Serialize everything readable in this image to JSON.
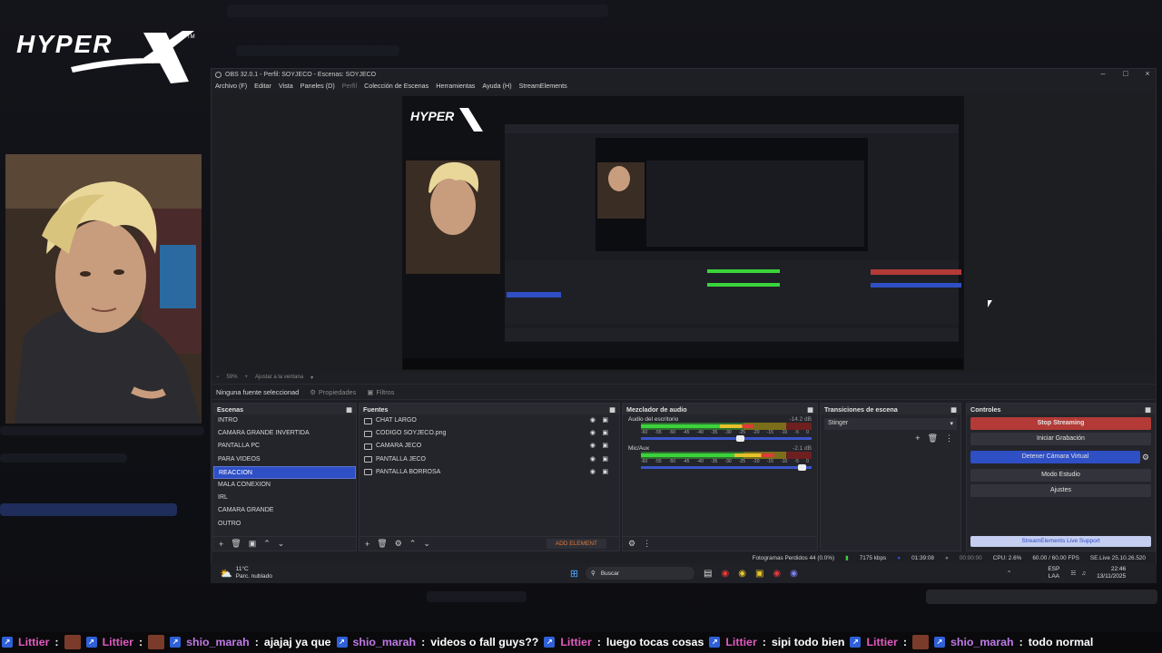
{
  "obs": {
    "title": "OBS 32.0.1 - Perfil: SOYJECO - Escenas: SOYJECO",
    "menu": [
      "Archivo (F)",
      "Editar",
      "Vista",
      "Paneles (D)",
      "Perfil",
      "Colección de Escenas",
      "Herramientas",
      "Ayuda (H)",
      "StreamElements"
    ],
    "zoom": "59%",
    "fit_label": "Ajustar a la ventana",
    "no_source": "Ninguna fuente seleccionad",
    "properties_tab": "Propiedades",
    "filters_tab": "Filtros"
  },
  "scenes": {
    "title": "Escenas",
    "items": [
      "INTRO",
      "CAMARA GRANDE INVERTIDA",
      "PANTALLA PC",
      "PARA VIDEOS",
      "REACCION",
      "MALA CONEXION",
      "IRL",
      "CAMARA GRANDE",
      "OUTRO"
    ],
    "selected_index": 4
  },
  "sources": {
    "title": "Fuentes",
    "items": [
      "CHAT LARGO",
      "CODIGO SOYJECO.png",
      "CAMARA JECO",
      "PANTALLA JECO",
      "PANTALLA BORROSA"
    ],
    "add_element": "ADD ELEMENT"
  },
  "mixer": {
    "title": "Mezclador de audio",
    "tracks": [
      {
        "name": "Audio del escritorio",
        "db": "-14.2 dB",
        "level": 0.66,
        "volume": 0.58
      },
      {
        "name": "Mic/Aux",
        "db": "-2.1 dB",
        "level": 0.78,
        "volume": 0.94
      }
    ],
    "scale": [
      "-60",
      "-55",
      "-50",
      "-45",
      "-40",
      "-35",
      "-30",
      "-25",
      "-20",
      "-15",
      "-10",
      "-5",
      "0"
    ]
  },
  "transitions": {
    "title": "Transiciones de escena",
    "selected": "Stinger"
  },
  "controls": {
    "title": "Controles",
    "stop_streaming": "Stop Streaming",
    "start_recording": "Iniciar Grabación",
    "stop_virtual_cam": "Detener Cámara Virtual",
    "studio_mode": "Modo Estudio",
    "settings": "Ajustes",
    "live_support": "StreamElements Live Support"
  },
  "status": {
    "dropped": "Fotogramas Perdidos 44 (0.0%)",
    "bitrate": "7175 kbps",
    "live_time": "01:39:08",
    "rec_time": "00:00:00",
    "cpu": "CPU: 2.6%",
    "fps": "60.00 / 60.00 FPS",
    "version": "SE.Live 25.10.26.520"
  },
  "taskbar": {
    "temp": "11°C",
    "weather": "Parc. nublado",
    "search": "Buscar",
    "lang1": "ESP",
    "lang2": "LAA",
    "time": "22:46",
    "date": "13/11/2025"
  },
  "ticker": [
    {
      "user": "Littier",
      "msg": ""
    },
    {
      "user": "Littier",
      "msg": ""
    },
    {
      "user": "shio_marah",
      "msg": "ajajaj ya que"
    },
    {
      "user": "shio_marah",
      "msg": "videos o fall guys??"
    },
    {
      "user": "Littier",
      "msg": "luego tocas cosas"
    },
    {
      "user": "Littier",
      "msg": "sipi todo bien"
    },
    {
      "user": "Littier",
      "msg": ""
    },
    {
      "user": "shio_marah",
      "msg": "todo normal"
    }
  ],
  "colors": {
    "accent": "#2f4fc5",
    "stop_stream": "#b33a36",
    "user_pink": "#e05bbf",
    "user_purple": "#c07ae6"
  },
  "icons": [
    "hyperx-logo",
    "eye-icon",
    "lock-icon",
    "gear-icon",
    "plus-icon",
    "trash-icon",
    "up-arrow-icon",
    "down-arrow-icon",
    "windows-start-icon",
    "search-icon"
  ]
}
